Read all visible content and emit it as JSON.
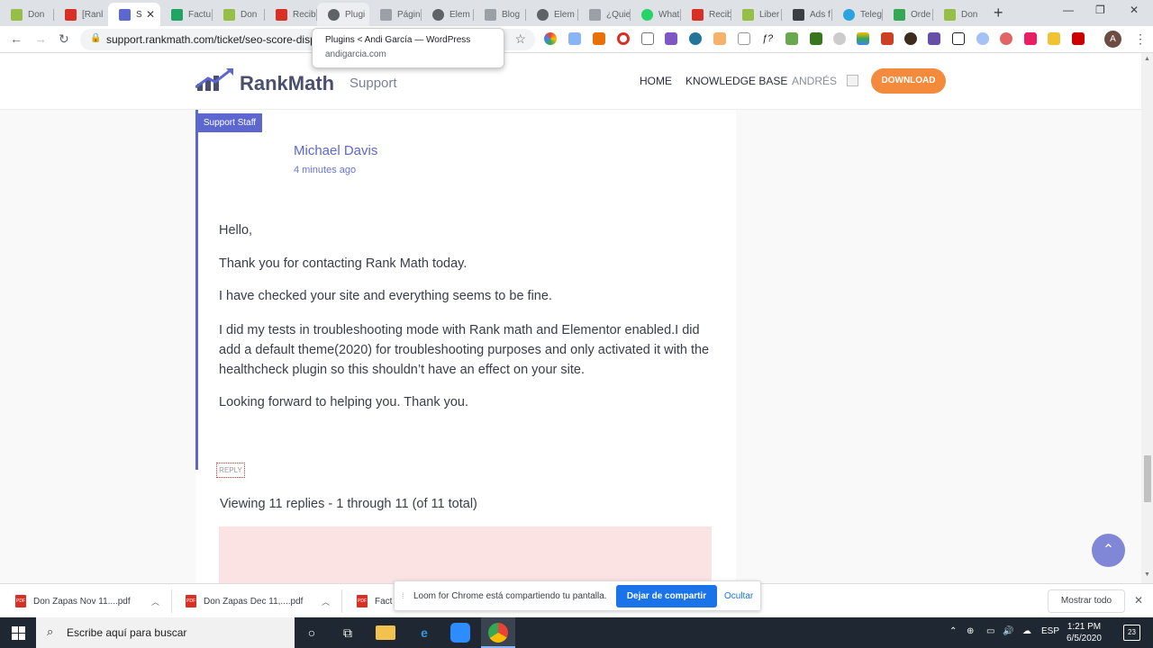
{
  "browser": {
    "tabs": [
      {
        "label": "Don",
        "icon": "shopify-icon",
        "color": "#95bf47"
      },
      {
        "label": "[Ranl",
        "icon": "gmail-icon",
        "color": "#d93025"
      },
      {
        "label": "S",
        "icon": "rankmath-icon",
        "color": "#5c67d0",
        "active": true
      },
      {
        "label": "Factu",
        "icon": "drive-icon",
        "color": "#1fa463"
      },
      {
        "label": "Don",
        "icon": "shopify-icon",
        "color": "#95bf47"
      },
      {
        "label": "Recib",
        "icon": "gmail-icon",
        "color": "#d93025"
      },
      {
        "label": "Plugi",
        "icon": "wordpress-icon",
        "color": "#5f6368"
      },
      {
        "label": "Págin",
        "icon": "elementor-icon",
        "color": "#5f6368"
      },
      {
        "label": "Elem",
        "icon": "wordpress-icon",
        "color": "#5f6368"
      },
      {
        "label": "Blog",
        "icon": "elementor-icon",
        "color": "#5f6368"
      },
      {
        "label": "Elem",
        "icon": "wordpress-icon",
        "color": "#5f6368"
      },
      {
        "label": "¿Quie",
        "icon": "elementor-icon",
        "color": "#5f6368"
      },
      {
        "label": "What",
        "icon": "whatsapp-icon",
        "color": "#25d366"
      },
      {
        "label": "Recib",
        "icon": "gmail-icon",
        "color": "#d93025"
      },
      {
        "label": "Liber",
        "icon": "shopify-icon",
        "color": "#95bf47"
      },
      {
        "label": "Ads f",
        "icon": "ads-icon",
        "color": "#3c4043"
      },
      {
        "label": "Teleg",
        "icon": "telegram-icon",
        "color": "#2aa3e0"
      },
      {
        "label": "Orde",
        "icon": "signal-icon",
        "color": "#34a853"
      },
      {
        "label": "Don",
        "icon": "shopify-icon",
        "color": "#95bf47"
      }
    ],
    "url": "support.rankmath.com/ticket/seo-score-disp",
    "tooltip": {
      "title": "Plugins < Andi García — WordPress",
      "domain": "andigarcia.com"
    },
    "profile_initial": "A"
  },
  "site": {
    "logo": "RankMath",
    "logo_sub": "Support",
    "nav": [
      "HOME",
      "KNOWLEDGE BASE",
      "ANDRÉS"
    ],
    "download": "DOWNLOAD"
  },
  "reply": {
    "badge": "Support Staff",
    "author": "Michael Davis",
    "time": "4 minutes ago",
    "paragraphs": [
      "Hello,",
      "Thank you for contacting Rank Math today.",
      "I have checked your site and everything seems to be fine.",
      "I did my tests in troubleshooting mode with Rank math and Elementor enabled.I did add a default theme(2020) for troubleshooting purposes and only activated it with the healthcheck plugin so this shouldn’t have an effect on your site.",
      "Looking forward to helping you. Thank you."
    ],
    "reply_label": "REPLY",
    "viewing": "Viewing 11 replies - 1 through 11 (of 11 total)"
  },
  "downloads": {
    "items": [
      "Don Zapas Nov 11....pdf",
      "Don Zapas Dec 11,....pdf",
      "Fact"
    ],
    "file_type": "PDF",
    "show_all": "Mostrar todo"
  },
  "loom": {
    "message": "Loom for Chrome está compartiendo tu pantalla.",
    "stop": "Dejar de compartir",
    "hide": "Ocultar"
  },
  "taskbar": {
    "search_placeholder": "Escribe aquí para buscar",
    "language": "ESP",
    "time": "1:21 PM",
    "date": "6/5/2020",
    "notifications": "23"
  }
}
